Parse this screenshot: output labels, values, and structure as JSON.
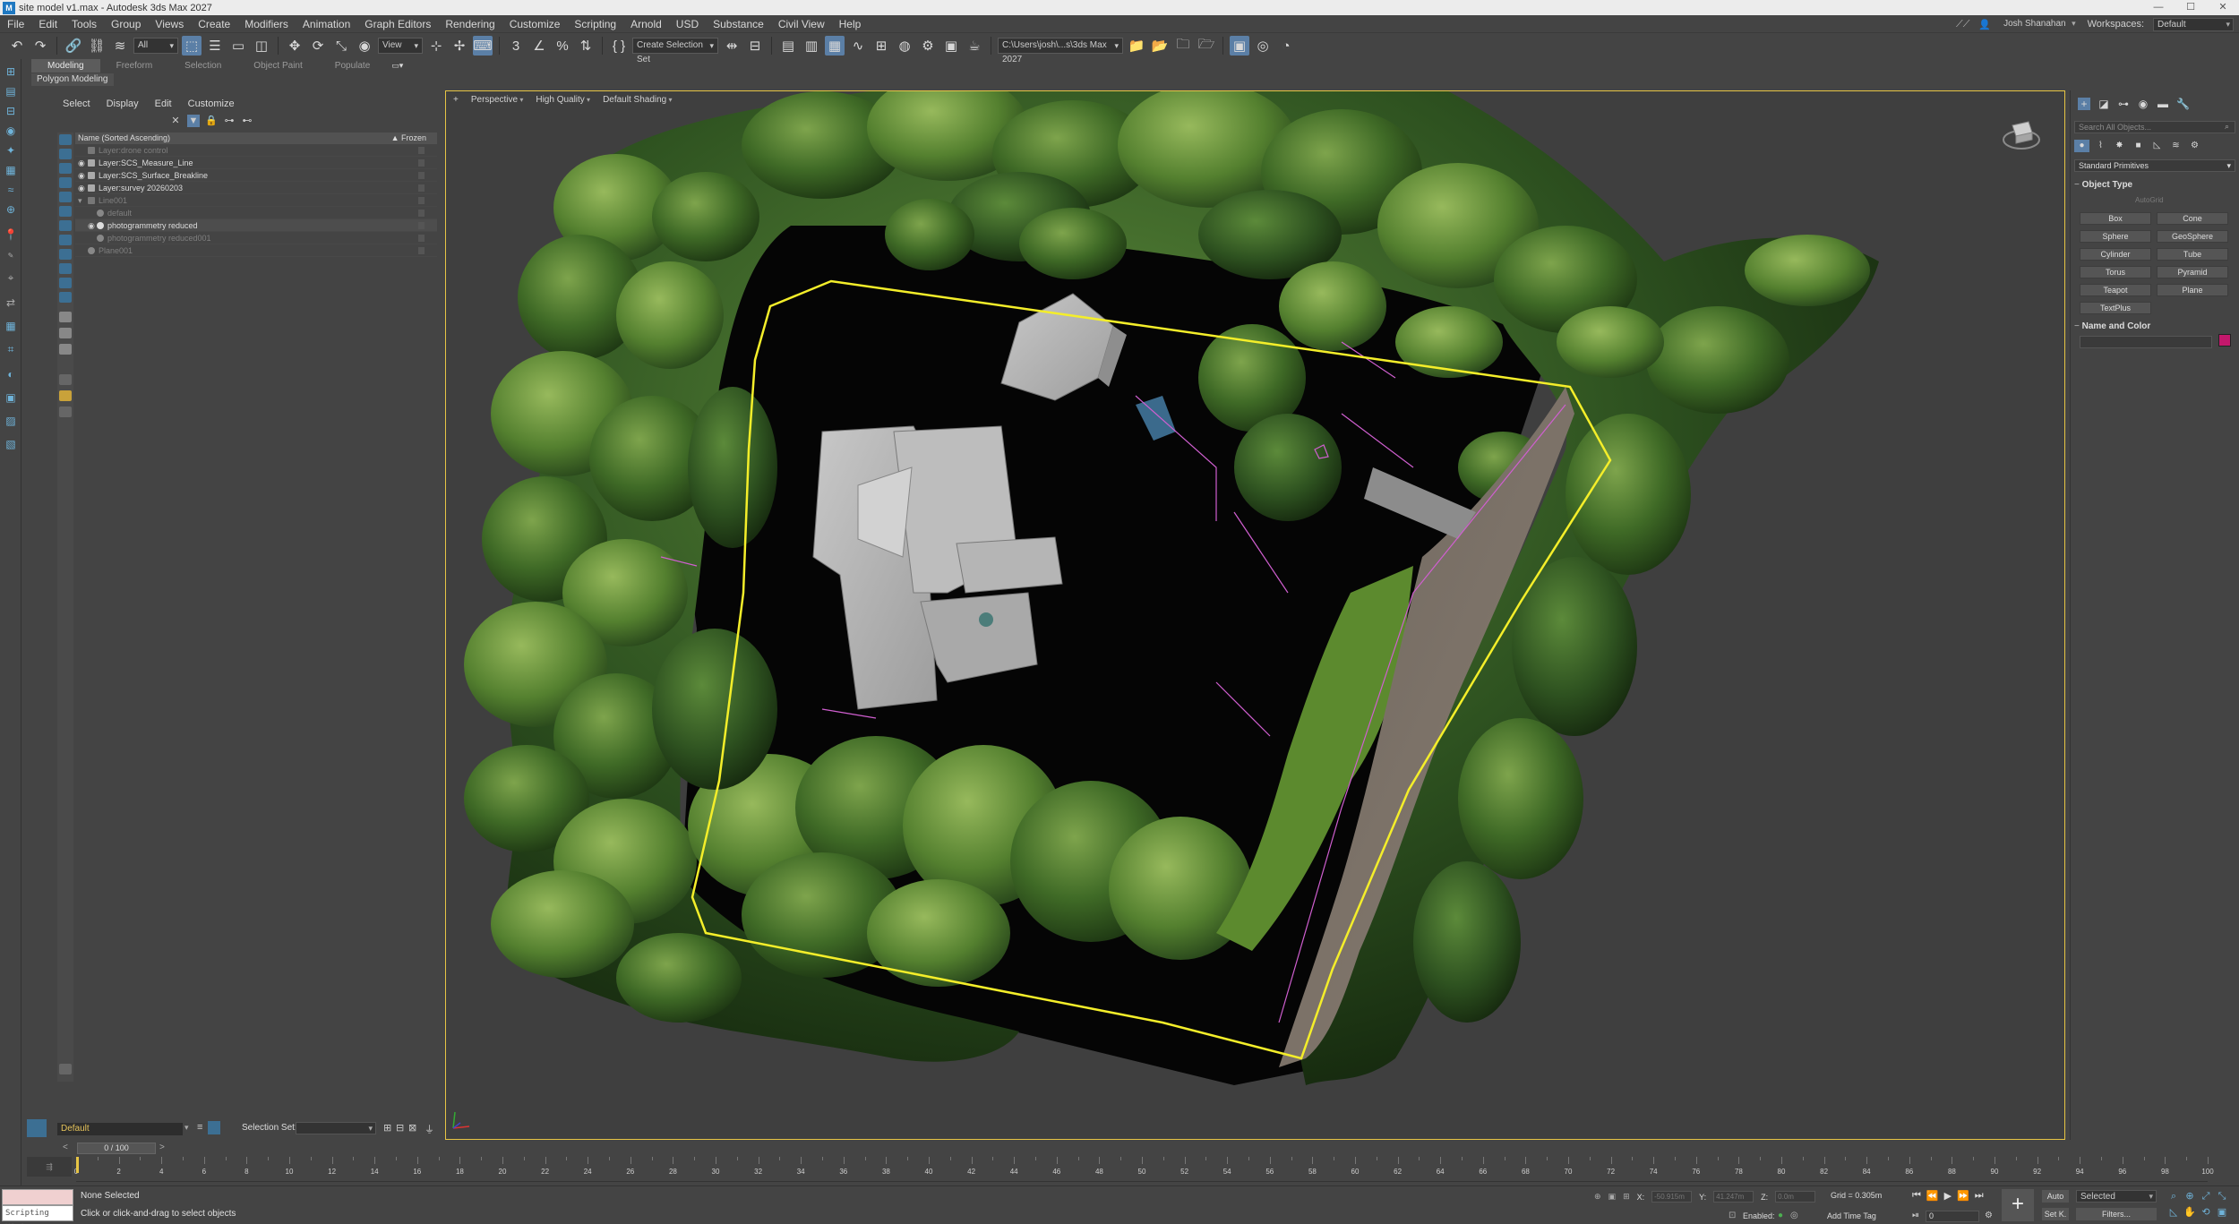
{
  "window": {
    "title": "site model v1.max - Autodesk 3ds Max 2027"
  },
  "menu": {
    "items": [
      "File",
      "Edit",
      "Tools",
      "Group",
      "Views",
      "Create",
      "Modifiers",
      "Animation",
      "Graph Editors",
      "Rendering",
      "Customize",
      "Scripting",
      "Arnold",
      "USD",
      "Substance",
      "Civil View",
      "Help"
    ],
    "user": "Josh Shanahan",
    "workspaces_label": "Workspaces:",
    "workspace_value": "Default"
  },
  "toolbar": {
    "selection_filter": "All",
    "ref_coord": "View",
    "named_selection": "Create Selection Set",
    "project_path": "C:\\Users\\josh\\...s\\3ds Max 2027"
  },
  "ribbon": {
    "tabs": [
      "Modeling",
      "Freeform",
      "Selection",
      "Object Paint",
      "Populate"
    ],
    "sub_label": "Polygon Modeling"
  },
  "explorer": {
    "tabs": [
      "Select",
      "Display",
      "Edit",
      "Customize"
    ],
    "column_header": "Name (Sorted Ascending)",
    "frozen_header": "▲ Frozen",
    "rows": [
      {
        "label": "Layer:drone control",
        "dim": true
      },
      {
        "label": "Layer:SCS_Measure_Line",
        "dim": false
      },
      {
        "label": "Layer:SCS_Surface_Breakline",
        "dim": false
      },
      {
        "label": "Layer:survey 20260203",
        "dim": false
      },
      {
        "label": "Line001",
        "dim": true
      },
      {
        "label": "default",
        "dim": true
      },
      {
        "label": "photogrammetry reduced",
        "dim": false
      },
      {
        "label": "photogrammetry reduced001",
        "dim": true
      },
      {
        "label": "Plane001",
        "dim": true
      }
    ],
    "current_layer": "Default",
    "selection_set_label": "Selection Set:"
  },
  "viewport": {
    "labels": [
      "+",
      "Perspective",
      "High Quality",
      "Default Shading"
    ]
  },
  "command_panel": {
    "search_placeholder": "Search All Objects...",
    "category": "Standard Primitives",
    "object_type_title": "Object Type",
    "autogrid": "AutoGrid",
    "primitives": [
      "Box",
      "Cone",
      "Sphere",
      "GeoSphere",
      "Cylinder",
      "Tube",
      "Torus",
      "Pyramid",
      "Teapot",
      "Plane",
      "TextPlus"
    ],
    "name_color_title": "Name and Color",
    "object_color": "#c4186c"
  },
  "timeline": {
    "frame_display": "0 / 100",
    "ticks": [
      "0",
      "2",
      "4",
      "6",
      "8",
      "10",
      "12",
      "14",
      "16",
      "18",
      "20",
      "22",
      "24",
      "26",
      "28",
      "30",
      "32",
      "34",
      "36",
      "38",
      "40",
      "42",
      "44",
      "46",
      "48",
      "50",
      "52",
      "54",
      "56",
      "58",
      "60",
      "62",
      "64",
      "66",
      "68",
      "70",
      "72",
      "74",
      "76",
      "78",
      "80",
      "82",
      "84",
      "86",
      "88",
      "90",
      "92",
      "94",
      "96",
      "98",
      "100"
    ]
  },
  "status": {
    "maxscript": "Scripting Mini",
    "selection": "None Selected",
    "prompt": "Click or click-and-drag to select objects",
    "x_label": "X:",
    "y_label": "Y:",
    "z_label": "Z:",
    "x_val": "-50.915m",
    "y_val": "41.247m",
    "z_val": "0.0m",
    "grid": "Grid = 0.305m",
    "enabled": "Enabled:",
    "add_time_tag": "Add Time Tag",
    "auto": "Auto",
    "set_k": "Set K.",
    "selected": "Selected",
    "filters": "Filters...",
    "frame": "0"
  },
  "colors": {
    "accent": "#5b7fa6",
    "viewport_border": "#e7c545",
    "boundary_line": "#f4ee2a",
    "breakline": "#d05fd0"
  }
}
